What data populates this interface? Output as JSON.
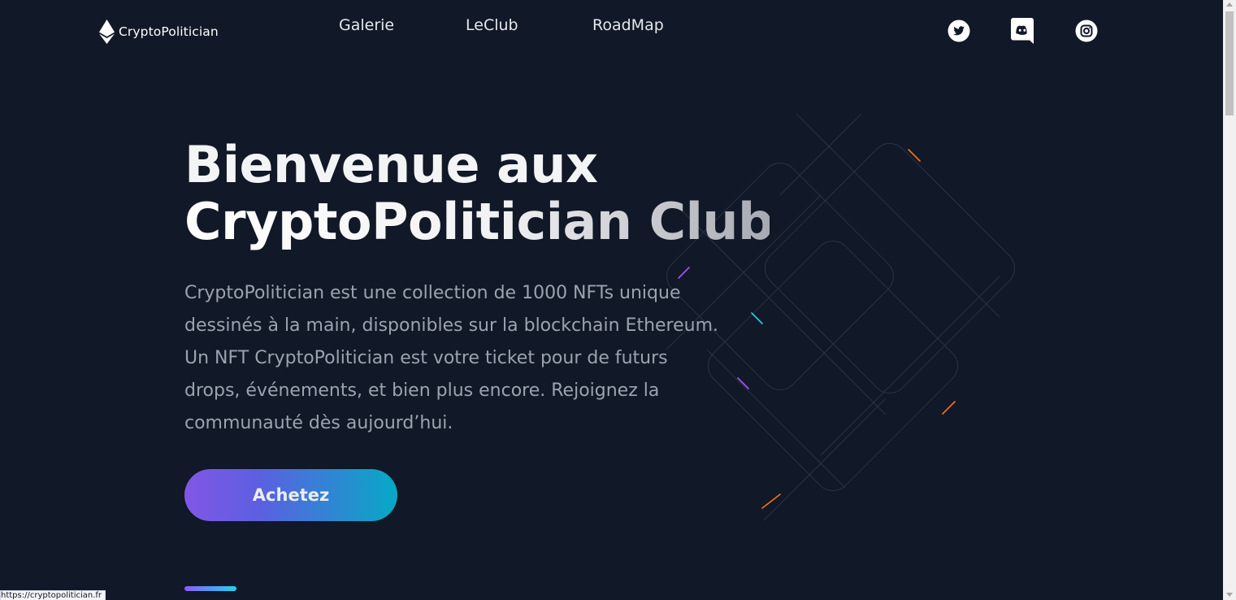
{
  "brand": {
    "name": "CryptoPolitician",
    "logo_icon": "ethereum-icon"
  },
  "nav": {
    "items": [
      {
        "label": "Galerie"
      },
      {
        "label": "LeClub"
      },
      {
        "label": "RoadMap"
      }
    ]
  },
  "social": {
    "icons": [
      "twitter-icon",
      "discord-icon",
      "instagram-icon"
    ]
  },
  "hero": {
    "title_line1": "Bienvenue aux",
    "title_line2": "CryptoPolitician Club",
    "description": "CryptoPolitician est une collection de 1000 NFTs unique dessinés à la main, disponibles sur la blockchain Ethereum. Un NFT CryptoPolitician est votre ticket pour de futurs drops, événements, et bien plus encore. Rejoignez la communauté dès aujourd’hui.",
    "cta_label": "Achetez"
  },
  "status_bar": {
    "url": "https://cryptopolitician.fr"
  },
  "colors": {
    "background": "#111827",
    "gradient_start": "#8b5cf6",
    "gradient_end": "#06b6d4",
    "muted_text": "#9ca3af"
  }
}
